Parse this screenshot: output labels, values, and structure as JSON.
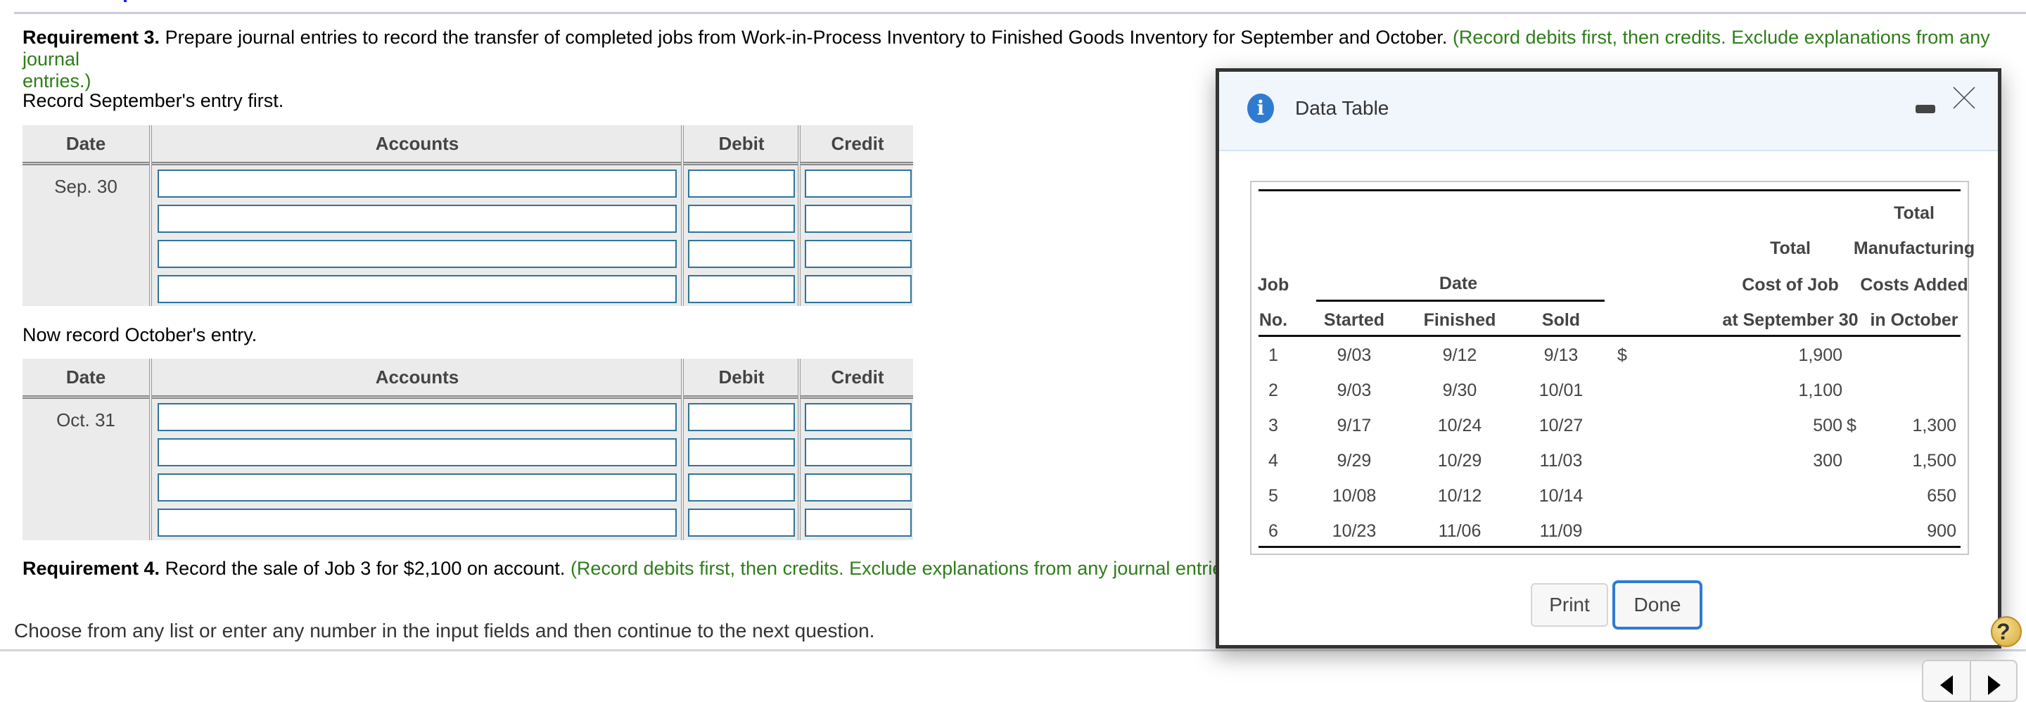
{
  "requirement3": {
    "label": "Requirement 3.",
    "text": " Prepare journal entries to record the transfer of completed jobs from Work-in-Process Inventory to Finished Goods Inventory for September and October.",
    "instruction_line1": " (Record debits first, then credits. Exclude explanations from any journal",
    "instruction_line2": "entries.)"
  },
  "september": {
    "prompt": "Record September's entry first.",
    "headers": {
      "date": "Date",
      "accounts": "Accounts",
      "debit": "Debit",
      "credit": "Credit"
    },
    "date": "Sep. 30",
    "rows": [
      {
        "account": "",
        "debit": "",
        "credit": ""
      },
      {
        "account": "",
        "debit": "",
        "credit": ""
      },
      {
        "account": "",
        "debit": "",
        "credit": ""
      },
      {
        "account": "",
        "debit": "",
        "credit": ""
      }
    ]
  },
  "october": {
    "prompt": "Now record October's entry.",
    "headers": {
      "date": "Date",
      "accounts": "Accounts",
      "debit": "Debit",
      "credit": "Credit"
    },
    "date": "Oct. 31",
    "rows": [
      {
        "account": "",
        "debit": "",
        "credit": ""
      },
      {
        "account": "",
        "debit": "",
        "credit": ""
      },
      {
        "account": "",
        "debit": "",
        "credit": ""
      },
      {
        "account": "",
        "debit": "",
        "credit": ""
      }
    ]
  },
  "requirement4": {
    "label": "Requirement 4.",
    "text": " Record the sale of Job 3 for $2,100 on account.",
    "instruction": " (Record debits first, then credits. Exclude explanations from any journal entries.)"
  },
  "footer_hint": "Choose from any list or enter any number in the input fields and then continue to the next question.",
  "modal": {
    "title": "Data Table",
    "icons": {
      "info": "info-icon",
      "minimize": "minimize-icon",
      "close": "close-icon"
    },
    "info_glyph": "i",
    "headers": {
      "job1": "Job",
      "job2": "No.",
      "date_group": "Date",
      "started": "Started",
      "finished": "Finished",
      "sold": "Sold",
      "cost1": "Total",
      "cost2": "Cost of Job",
      "cost3": "at September 30",
      "mfg1": "Total",
      "mfg2": "Manufacturing",
      "mfg3": "Costs Added",
      "mfg4": "in October"
    },
    "currency_symbol": "$",
    "rows": [
      {
        "job": "1",
        "started": "9/03",
        "finished": "9/12",
        "sold": "9/13",
        "cost_sep30": "1,900",
        "cost_sep30_dollar": "$",
        "added_oct": "",
        "added_oct_dollar": ""
      },
      {
        "job": "2",
        "started": "9/03",
        "finished": "9/30",
        "sold": "10/01",
        "cost_sep30": "1,100",
        "cost_sep30_dollar": "",
        "added_oct": "",
        "added_oct_dollar": ""
      },
      {
        "job": "3",
        "started": "9/17",
        "finished": "10/24",
        "sold": "10/27",
        "cost_sep30": "500",
        "cost_sep30_dollar": "",
        "added_oct": "1,300",
        "added_oct_dollar": "$"
      },
      {
        "job": "4",
        "started": "9/29",
        "finished": "10/29",
        "sold": "11/03",
        "cost_sep30": "300",
        "cost_sep30_dollar": "",
        "added_oct": "1,500",
        "added_oct_dollar": ""
      },
      {
        "job": "5",
        "started": "10/08",
        "finished": "10/12",
        "sold": "10/14",
        "cost_sep30": "",
        "cost_sep30_dollar": "",
        "added_oct": "650",
        "added_oct_dollar": ""
      },
      {
        "job": "6",
        "started": "10/23",
        "finished": "11/06",
        "sold": "11/09",
        "cost_sep30": "",
        "cost_sep30_dollar": "",
        "added_oct": "900",
        "added_oct_dollar": ""
      }
    ],
    "buttons": {
      "print": "Print",
      "done": "Done"
    }
  },
  "help_glyph": "?",
  "nav": {
    "prev": "previous-arrow",
    "next": "next-arrow"
  },
  "colors": {
    "instruction_green": "#2e7d1a",
    "input_border": "#2e7599",
    "accent_blue": "#2f7bd0",
    "header_bg": "#ebebeb",
    "modal_header_bg": "#f1f5fc"
  }
}
